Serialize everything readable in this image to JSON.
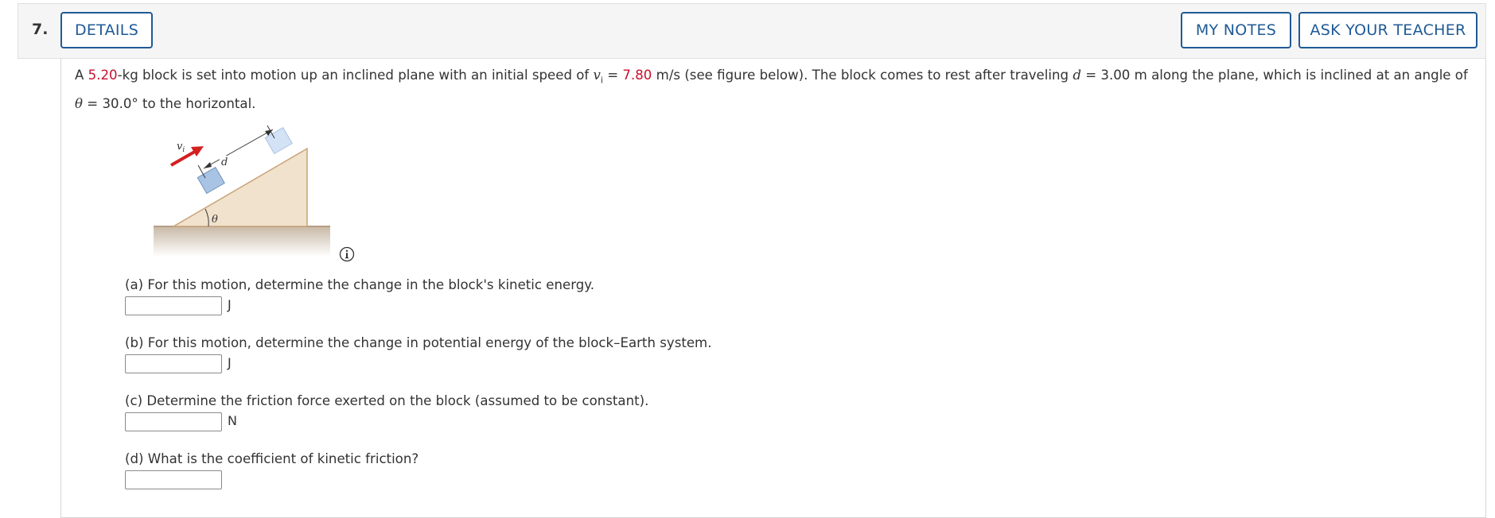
{
  "question": {
    "number": "7.",
    "buttons": {
      "details": "DETAILS",
      "my_notes": "MY NOTES",
      "ask_teacher": "ASK YOUR TEACHER"
    }
  },
  "problem": {
    "t1": "A ",
    "mass": "5.20",
    "t2": "-kg block is set into motion up an inclined plane with an initial speed of ",
    "vi_symbol": "v",
    "vi_sub": "i",
    "t3": " = ",
    "speed": "7.80",
    "t4": " m/s (see figure below). The block comes to rest after traveling ",
    "d_symbol": "d",
    "t5": " = 3.00 m along the plane, which is inclined at an angle of ",
    "theta_symbol": "θ",
    "t6": " = 30.0° to the horizontal."
  },
  "figure": {
    "labels": {
      "vi": "v",
      "vi_sub": "i",
      "d": "d",
      "theta": "θ"
    },
    "colors": {
      "incline": "#f0e2cc",
      "incline_edge": "#c9a37a",
      "block": "#a9c3e4",
      "block_light": "#d3e2f4",
      "arrow": "#d42020",
      "ground": "#c8b9a6"
    }
  },
  "parts": [
    {
      "label": "(a) For this motion, determine the change in the block's kinetic energy.",
      "unit": "J",
      "value": ""
    },
    {
      "label": "(b) For this motion, determine the change in potential energy of the block–Earth system.",
      "unit": "J",
      "value": ""
    },
    {
      "label": "(c) Determine the friction force exerted on the block (assumed to be constant).",
      "unit": "N",
      "value": ""
    },
    {
      "label": "(d) What is the coefficient of kinetic friction?",
      "unit": "",
      "value": ""
    }
  ]
}
